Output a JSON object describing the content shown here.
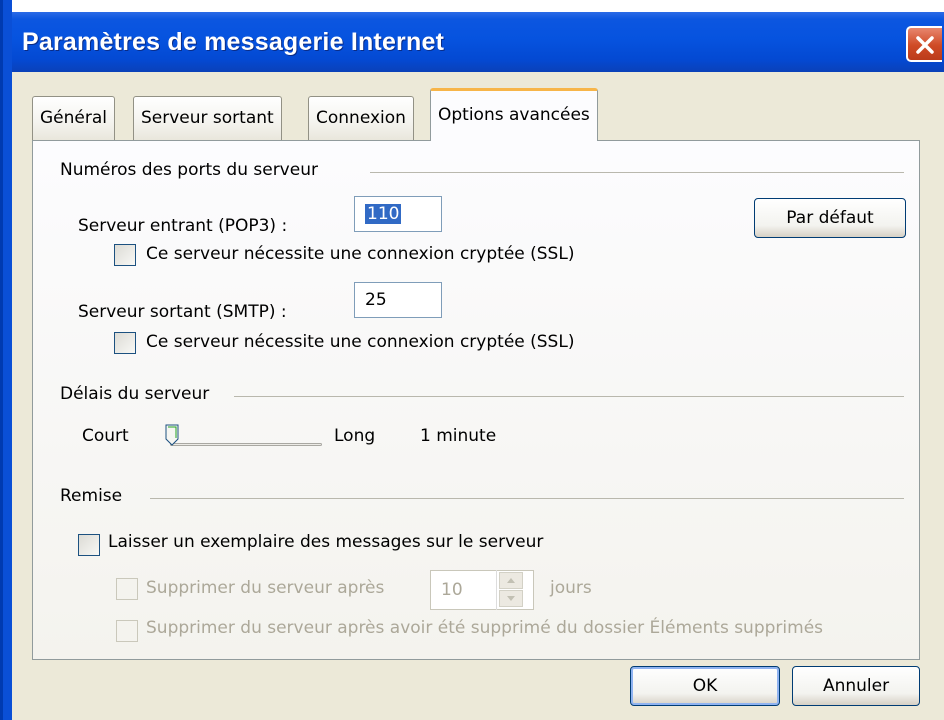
{
  "window": {
    "title": "Paramètres de messagerie Internet"
  },
  "tabs": [
    {
      "label": "Général",
      "active": false
    },
    {
      "label": "Serveur sortant",
      "active": false
    },
    {
      "label": "Connexion",
      "active": false
    },
    {
      "label": "Options avancées",
      "active": true
    }
  ],
  "ports_group": {
    "title": "Numéros des ports du serveur",
    "incoming": {
      "label": "Serveur entrant (POP3) :",
      "value": "110",
      "ssl_label": "Ce serveur nécessite une connexion cryptée (SSL)",
      "ssl_checked": false
    },
    "outgoing": {
      "label": "Serveur sortant (SMTP) :",
      "value": "25",
      "ssl_label": "Ce serveur nécessite une connexion cryptée (SSL)",
      "ssl_checked": false
    },
    "default_button": "Par défaut"
  },
  "timeout_group": {
    "title": "Délais du serveur",
    "short_label": "Court",
    "long_label": "Long",
    "value_text": "1 minute",
    "slider_position": 0.1
  },
  "delivery_group": {
    "title": "Remise",
    "leave_copy_label": "Laisser un exemplaire des messages sur le serveur",
    "leave_copy_checked": false,
    "remove_after": {
      "label": "Supprimer du serveur après",
      "value": "10",
      "unit": "jours",
      "checked": false,
      "enabled": false
    },
    "remove_when_deleted": {
      "label": "Supprimer du serveur après avoir été supprimé du dossier Éléments supprimés",
      "checked": false,
      "enabled": false
    }
  },
  "buttons": {
    "ok": "OK",
    "cancel": "Annuler"
  },
  "colors": {
    "titlebar": "#0653df",
    "dialog_bg": "#ece9d8",
    "active_tab_highlight": "#f7b549",
    "selection": "#316ac5"
  },
  "icons": {
    "close": "close-x-icon"
  }
}
